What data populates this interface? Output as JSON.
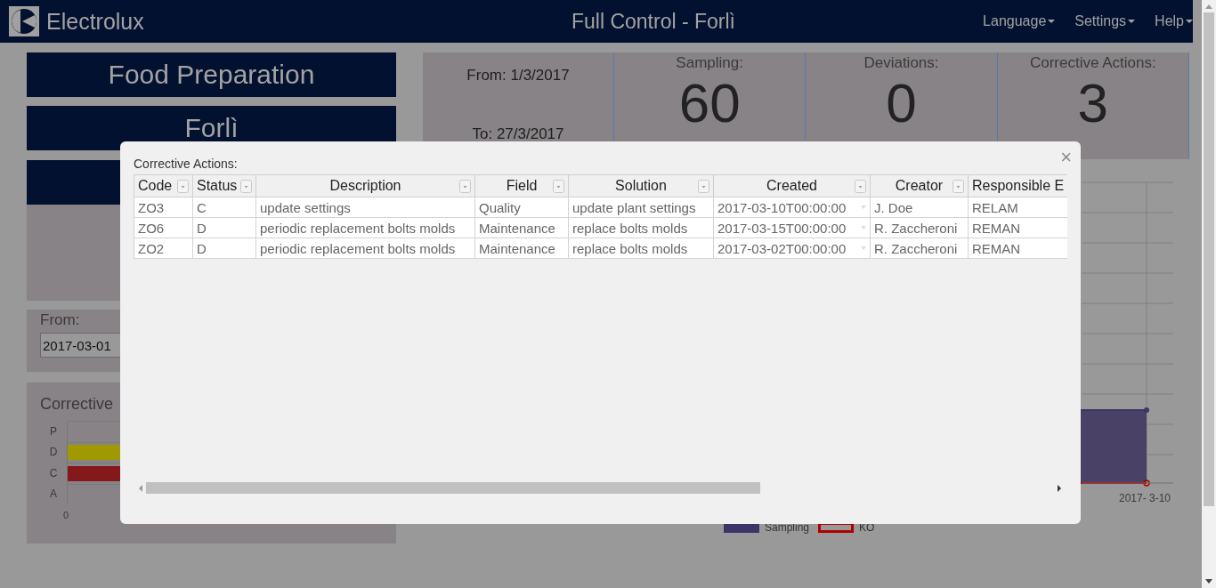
{
  "header": {
    "logo_text": "Electrolux",
    "title": "Full Control - Forlì",
    "menu": [
      {
        "label": "Language"
      },
      {
        "label": "Settings"
      },
      {
        "label": "Help"
      }
    ]
  },
  "sidebar": {
    "titles": [
      "Food Preparation",
      "Forlì"
    ],
    "from_label": "From:",
    "from_value": "2017-03-01",
    "chart": {
      "title": "Corrective",
      "tick": "0",
      "categories": [
        {
          "label": "P"
        },
        {
          "label": "D",
          "color": "#a09a00"
        },
        {
          "label": "C",
          "color": "#84181a"
        },
        {
          "label": "A"
        }
      ]
    }
  },
  "summary": {
    "from": "From: 1/3/2017",
    "to": "To: 27/3/2017",
    "stats": [
      {
        "label": "Sampling:",
        "value": "60"
      },
      {
        "label": "Deviations:",
        "value": "0"
      },
      {
        "label": "Corrective Actions:",
        "value": "3"
      }
    ]
  },
  "trend_chart": {
    "x_label": "2017- 3-10",
    "legend": [
      {
        "label": "Sampling",
        "kind": "filled",
        "color": "#3c3668"
      },
      {
        "label": "KO",
        "kind": "outline",
        "color": "#b00000"
      }
    ]
  },
  "dialog": {
    "title": "Corrective Actions:",
    "close": "×",
    "columns": [
      {
        "label": "Code",
        "filter": true
      },
      {
        "label": "Status",
        "filter": true
      },
      {
        "label": "Description",
        "filter": true
      },
      {
        "label": "Field",
        "filter": true
      },
      {
        "label": "Solution",
        "filter": true
      },
      {
        "label": "Created",
        "filter": true,
        "dropdown": true
      },
      {
        "label": "Creator",
        "filter": true
      },
      {
        "label": "Responsible E",
        "filter": false
      }
    ],
    "rows": [
      [
        "ZO3",
        "C",
        "update settings",
        "Quality",
        "update plant settings",
        "2017-03-10T00:00:00",
        "J. Doe",
        "RELAM"
      ],
      [
        "ZO6",
        "D",
        "periodic replacement bolts molds",
        "Maintenance",
        "replace bolts molds",
        "2017-03-15T00:00:00",
        "R. Zaccheroni",
        "REMAN"
      ],
      [
        "ZO2",
        "D",
        "periodic replacement bolts molds",
        "Maintenance",
        "replace bolts molds",
        "2017-03-02T00:00:00",
        "R. Zaccheroni",
        "REMAN"
      ]
    ]
  }
}
